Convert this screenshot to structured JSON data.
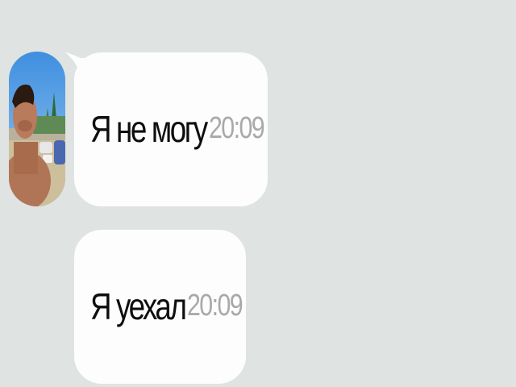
{
  "chat": {
    "contact_avatar_icon": "person-photo-icon",
    "messages": [
      {
        "text": "Я не могу",
        "time": "20:09"
      },
      {
        "text": "Я уехал",
        "time": "20:09"
      }
    ]
  },
  "colors": {
    "background": "#dfe3e2",
    "bubble": "#fdfdfd",
    "text": "#0e0e0e",
    "time": "#a9a9a9"
  }
}
